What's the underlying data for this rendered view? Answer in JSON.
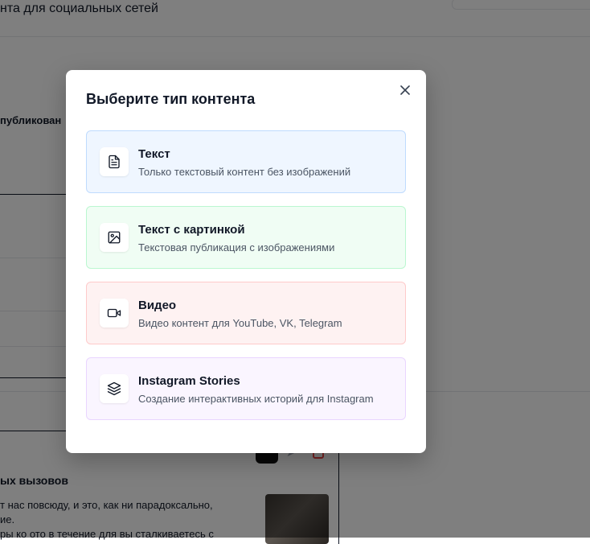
{
  "background": {
    "page_title": "нта для социальных сетей",
    "published_label": "публикован",
    "post_heading": "ых вызовов",
    "post_text_1": "т нас повсюду, и это, как ни парадоксально,",
    "post_text_2": "ие.",
    "post_text_3": "ры ко ото в течение для вы сталкиваетесь с"
  },
  "modal": {
    "title": "Выберите тип контента",
    "close_icon": "close-icon",
    "options": [
      {
        "title": "Текст",
        "description": "Только текстовый контент без изображений",
        "icon": "document-icon",
        "color": "#eff6ff"
      },
      {
        "title": "Текст с картинкой",
        "description": "Текстовая публикация с изображениями",
        "icon": "image-icon",
        "color": "#f0fdf4"
      },
      {
        "title": "Видео",
        "description": "Видео контент для YouTube, VK, Telegram",
        "icon": "video-icon",
        "color": "#fef2f2"
      },
      {
        "title": "Instagram Stories",
        "description": "Создание интерактивных историй для Instagram",
        "icon": "layers-icon",
        "color": "#faf5ff"
      }
    ]
  }
}
